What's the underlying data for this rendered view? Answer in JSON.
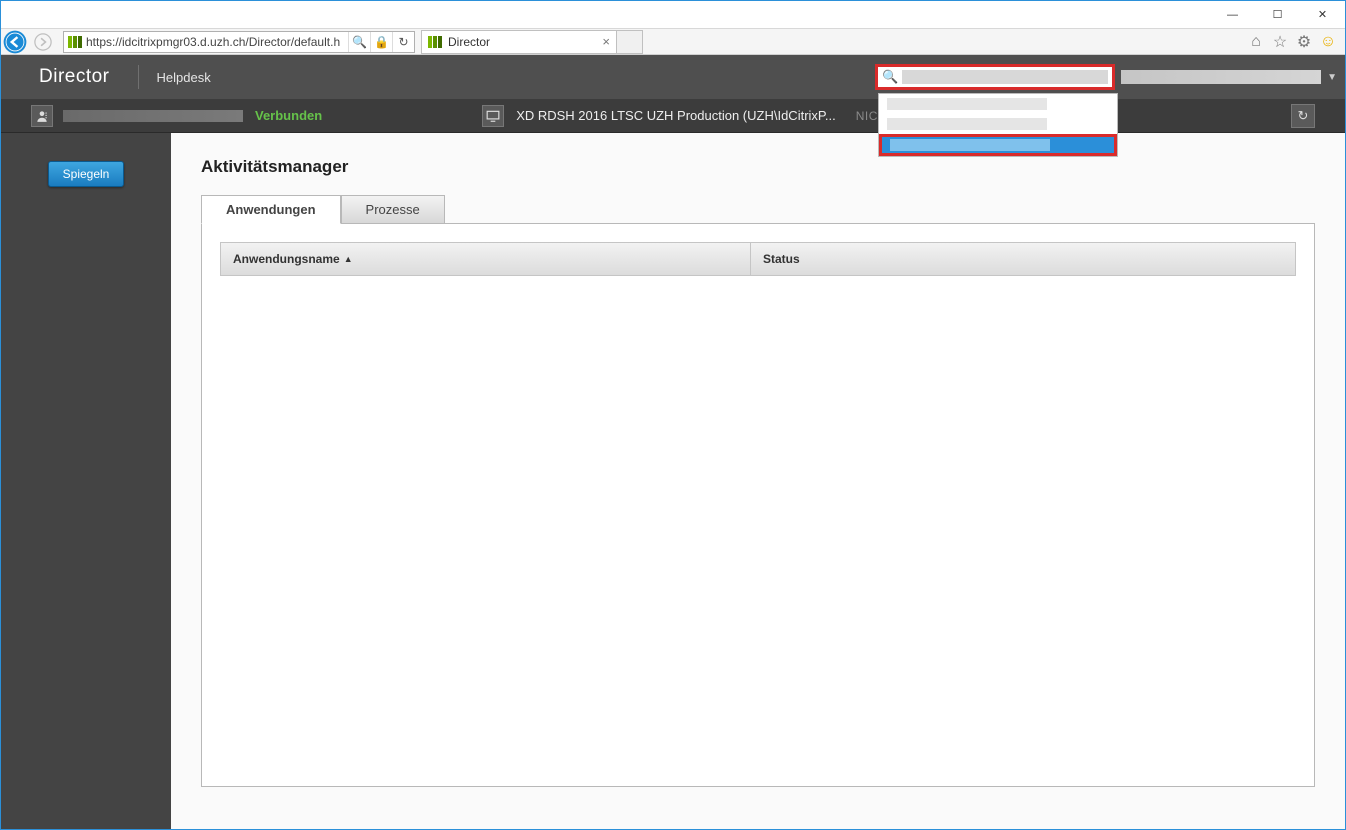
{
  "window": {
    "minimize": "—",
    "maximize": "☐",
    "close": "✕"
  },
  "browser": {
    "url": "https://idcitrixpmgr03.d.uzh.ch/Director/default.h",
    "tab_title": "Director",
    "tab_close": "×",
    "search_glyph": "🔍",
    "lock_glyph": "🔒",
    "refresh_glyph": "↻",
    "home_glyph": "⌂",
    "star_glyph": "☆",
    "gear_glyph": "⚙",
    "smile_glyph": "☺"
  },
  "topnav": {
    "logo": "Director",
    "helpdesk": "Helpdesk",
    "search_placeholder": "",
    "dropdown_caret": "▼"
  },
  "subbar": {
    "status": "Verbunden",
    "session_label": "XD RDSH 2016 LTSC UZH Production (UZH\\IdCitrixP...",
    "dim_label": "NICHT VERW",
    "refresh_glyph": "↻",
    "user_glyph": "👤",
    "monitor_glyph": "🖥"
  },
  "sidebar": {
    "spiegeln": "Spiegeln"
  },
  "main": {
    "title": "Aktivitätsmanager",
    "tabs": {
      "anwendungen": "Anwendungen",
      "prozesse": "Prozesse"
    },
    "columns": {
      "name": "Anwendungsname",
      "status": "Status",
      "sort": "▲"
    }
  }
}
